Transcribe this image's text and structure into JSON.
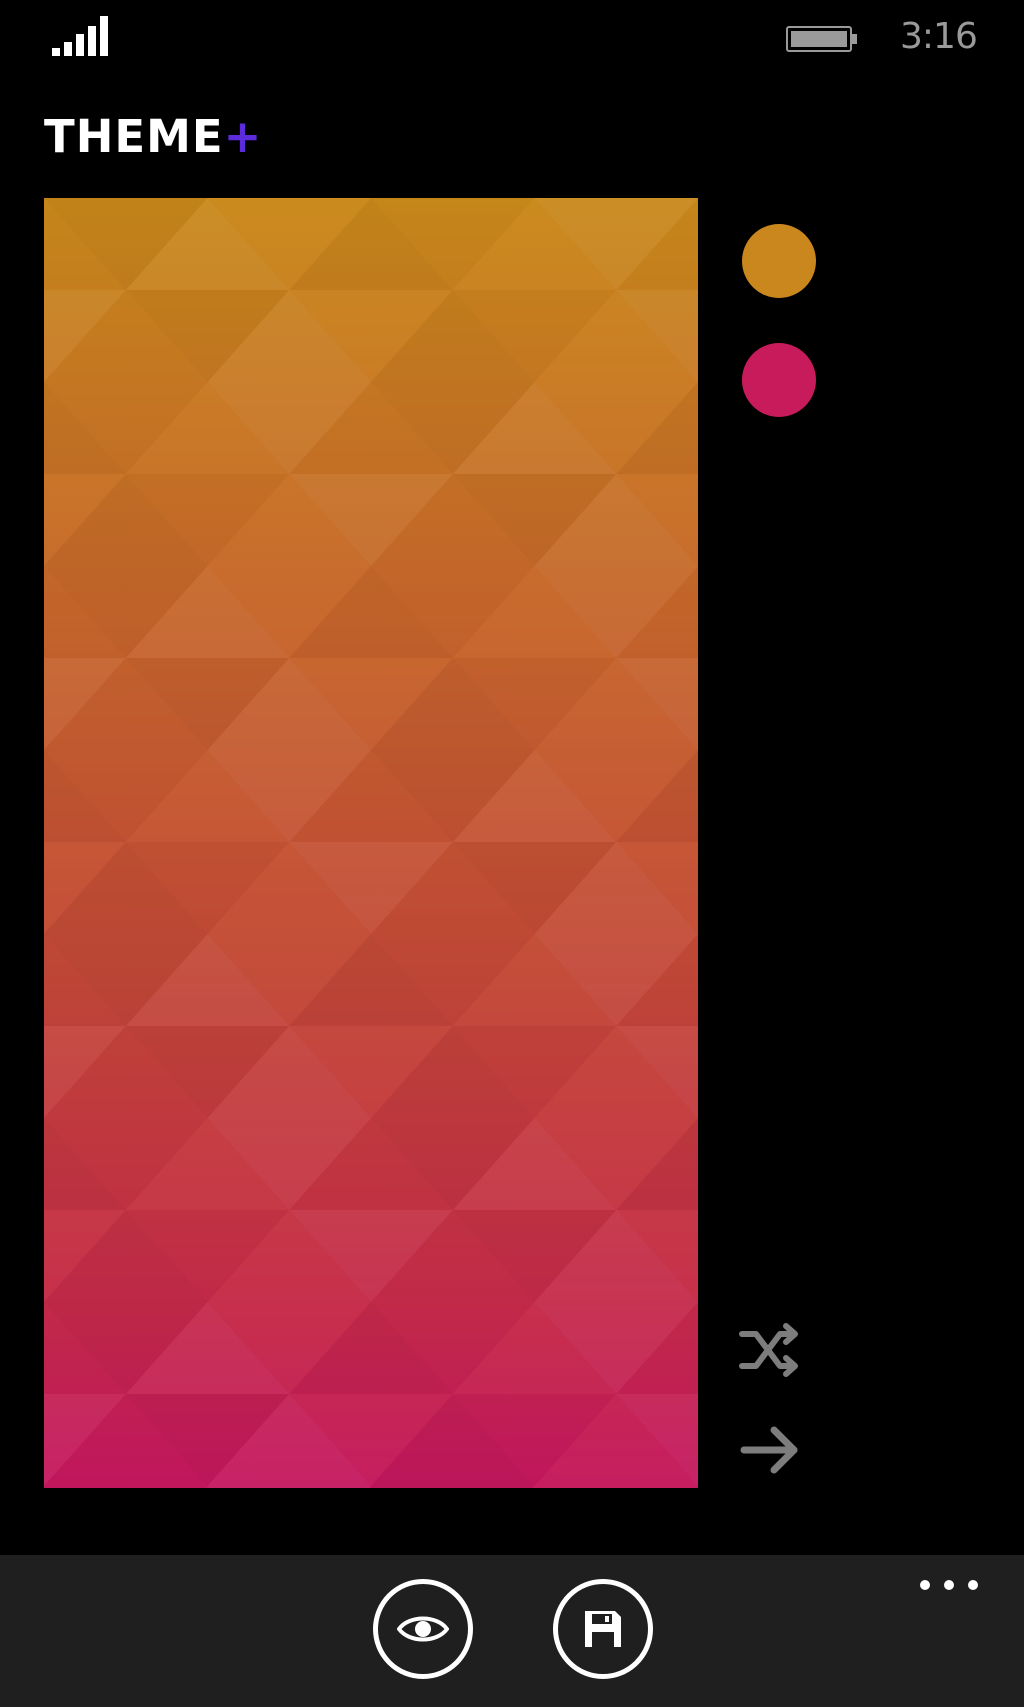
{
  "status_bar": {
    "time": "3:16",
    "signal_icon": "signal-bars-icon",
    "battery_icon": "battery-full-icon"
  },
  "header": {
    "title": "THEME",
    "title_suffix": "+",
    "suffix_color": "#5b2bdc"
  },
  "wallpaper": {
    "pattern": "triangle-mosaic",
    "gradient_top": "#c98a1c",
    "gradient_bottom": "#c4175f"
  },
  "swatches": [
    {
      "color": "#c9871e"
    },
    {
      "color": "#c81b5c"
    }
  ],
  "side_actions": [
    {
      "icon": "shuffle-icon"
    },
    {
      "icon": "arrow-right-icon"
    }
  ],
  "app_bar": {
    "buttons": [
      {
        "icon": "eye-icon"
      },
      {
        "icon": "save-floppy-icon"
      }
    ],
    "more_icon": "more-dots-icon"
  }
}
